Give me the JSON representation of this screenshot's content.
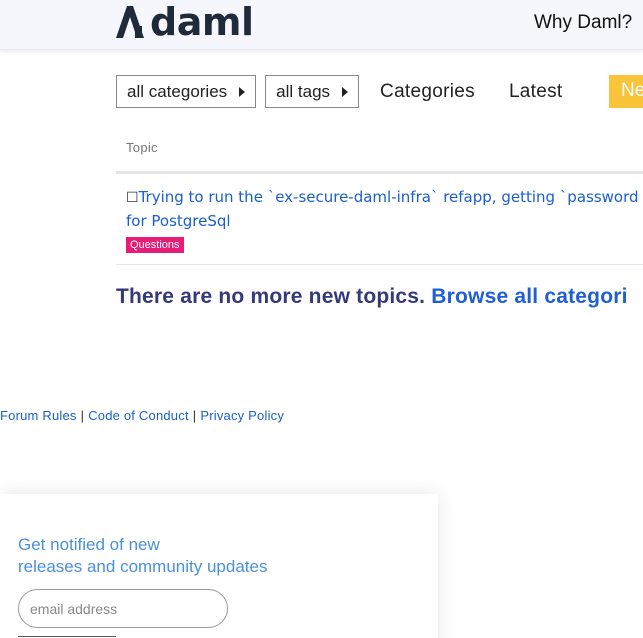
{
  "header": {
    "brand": "daml",
    "nav_why": "Why Daml?"
  },
  "filters": {
    "categories_dropdown": "all categories",
    "tags_dropdown": "all tags",
    "nav_categories": "Categories",
    "nav_latest": "Latest",
    "nav_new": "Ne",
    "new_color": "#f9c33a"
  },
  "topic_list": {
    "column_header": "Topic",
    "topics": [
      {
        "title_line1": "Trying to run the `ex-secure-daml-infra` refapp, getting `password au",
        "title_line2": "for PostgreSql",
        "category": "Questions",
        "category_color": "#e71c76"
      }
    ]
  },
  "empty_state": {
    "message": "There are no more new topics.",
    "browse_link": "Browse all categori"
  },
  "footer": {
    "links": [
      "Forum Rules",
      "Code of Conduct",
      "Privacy Policy"
    ],
    "separator": "|"
  },
  "newsletter": {
    "line1": "Get notified of new",
    "line2": "releases and community updates",
    "email_placeholder": "email address"
  }
}
